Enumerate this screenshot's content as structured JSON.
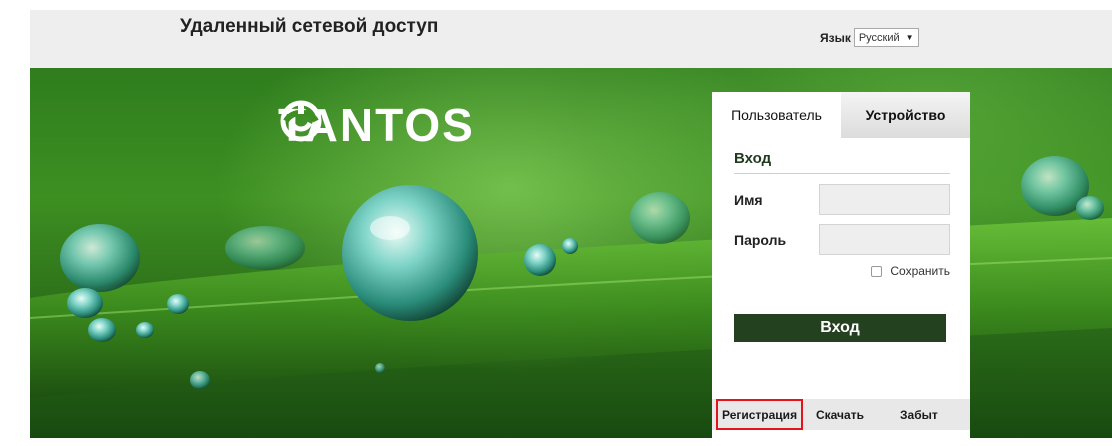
{
  "header": {
    "title": "Удаленный сетевой доступ",
    "language_label": "Язык",
    "language_value": "Русский"
  },
  "brand": {
    "name": "TANTOS"
  },
  "login": {
    "tabs": [
      {
        "label": "Пользователь",
        "active": true
      },
      {
        "label": "Устройство",
        "active": false
      }
    ],
    "heading": "Вход",
    "username_label": "Имя",
    "username_value": "",
    "password_label": "Пароль",
    "password_value": "",
    "remember_label": "Сохранить",
    "remember_checked": false,
    "submit_label": "Вход"
  },
  "footer_links": {
    "register": "Регистрация",
    "download": "Скачать",
    "forgot": "Забыт"
  },
  "colors": {
    "top_bar": "#eeeeee",
    "login_button": "#24411f",
    "highlight": "#e3141a"
  }
}
